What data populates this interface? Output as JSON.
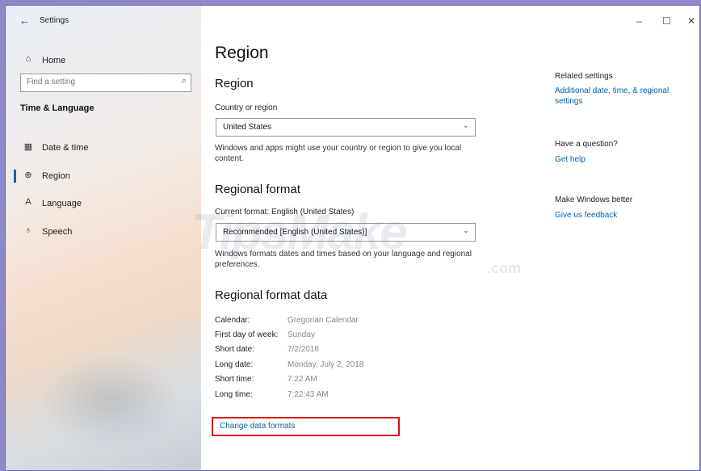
{
  "window": {
    "title": "Settings",
    "minimize": "–",
    "maximize": "☐",
    "close": "✕",
    "back": "←"
  },
  "sidebar": {
    "home": "Home",
    "search_placeholder": "Find a setting",
    "section": "Time & Language",
    "items": [
      {
        "label": "Date & time",
        "icon": "calendar-icon"
      },
      {
        "label": "Region",
        "icon": "globe-icon",
        "active": true
      },
      {
        "label": "Language",
        "icon": "language-icon"
      },
      {
        "label": "Speech",
        "icon": "microphone-icon"
      }
    ]
  },
  "main": {
    "title": "Region",
    "region": {
      "heading": "Region",
      "country_label": "Country or region",
      "country_value": "United States",
      "description": "Windows and apps might use your country or region to give you local content."
    },
    "regional_format": {
      "heading": "Regional format",
      "current_label": "Current format: English (United States)",
      "value": "Recommended [English (United States)]",
      "description": "Windows formats dates and times based on your language and regional preferences."
    },
    "format_data": {
      "heading": "Regional format data",
      "rows": [
        {
          "key": "Calendar:",
          "value": "Gregorian Calendar"
        },
        {
          "key": "First day of week:",
          "value": "Sunday"
        },
        {
          "key": "Short date:",
          "value": "7/2/2018"
        },
        {
          "key": "Long date:",
          "value": "Monday, July 2, 2018"
        },
        {
          "key": "Short time:",
          "value": "7:22 AM"
        },
        {
          "key": "Long time:",
          "value": "7:22:43 AM"
        }
      ],
      "change_link": "Change data formats"
    }
  },
  "related": {
    "heading": "Related settings",
    "link": "Additional date, time, & regional settings",
    "question_heading": "Have a question?",
    "help_link": "Get help",
    "better_heading": "Make Windows better",
    "feedback_link": "Give us feedback"
  },
  "watermark": {
    "brand": "TipsMake",
    "suffix": ".com"
  },
  "colors": {
    "accent": "#0063b1",
    "highlight_box": "#dd1111"
  }
}
